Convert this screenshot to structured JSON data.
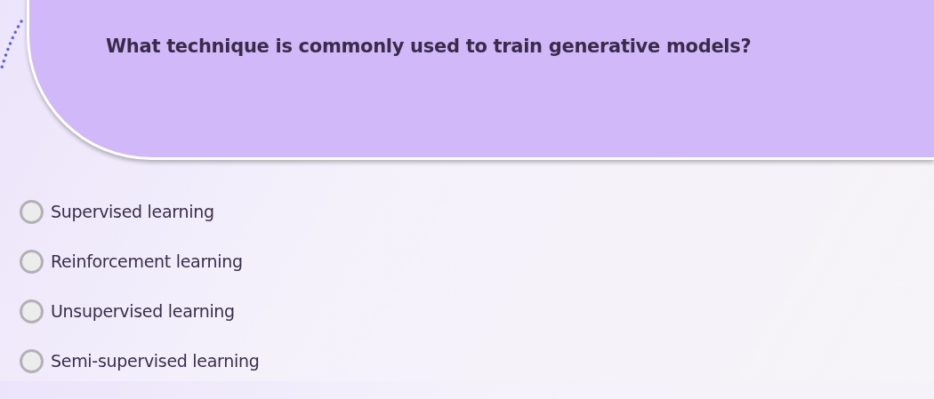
{
  "question": {
    "text": "What technique is commonly used to train generative models?"
  },
  "options": [
    {
      "label": "Supervised learning",
      "selected": false
    },
    {
      "label": "Reinforcement learning",
      "selected": false
    },
    {
      "label": "Unsupervised learning",
      "selected": false
    },
    {
      "label": "Semi-supervised learning",
      "selected": false
    }
  ]
}
